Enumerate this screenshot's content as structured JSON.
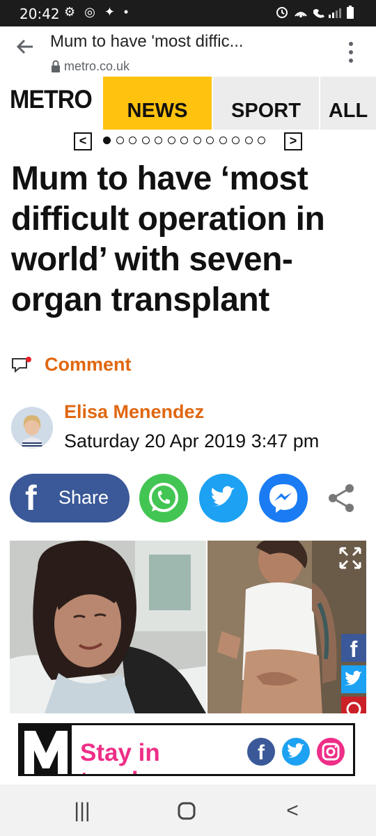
{
  "status_bar": {
    "time": "20:42",
    "left_icons": "⚙ ◎ ✦ •",
    "right_icons": "⏰ ◔ ☎ .❙"
  },
  "browser": {
    "page_title": "Mum to have 'most diffic...",
    "domain": "metro.co.uk"
  },
  "site_nav": {
    "logo": "METRO",
    "items": [
      {
        "label": "NEWS"
      },
      {
        "label": "SPORT"
      },
      {
        "label": "ALL"
      }
    ],
    "accent_color": "#ffc20e"
  },
  "carousel": {
    "prev": "<",
    "next": ">",
    "dot_count": 13,
    "active_index": 0
  },
  "article": {
    "headline": "Mum to have ‘most difficult operation in world’ with seven-organ transplant",
    "comment_label": "Comment",
    "author": "Elisa Menendez",
    "date": "Saturday 20 Apr 2019 3:47 pm"
  },
  "share": {
    "share_label": "Share",
    "facebook_glyph": "f"
  },
  "side_share": {
    "facebook_glyph": "f"
  },
  "stay_in_touch": {
    "text": "Stay in touch",
    "facebook_glyph": "f"
  },
  "colors": {
    "orange": "#e06710",
    "pink": "#ee2e87",
    "facebook": "#3b5998",
    "twitter": "#1da1f2",
    "whatsapp": "#43c553",
    "messenger": "#1a7bf2"
  },
  "system_nav": {
    "recents_glyph": "|||",
    "back_glyph": "<"
  }
}
